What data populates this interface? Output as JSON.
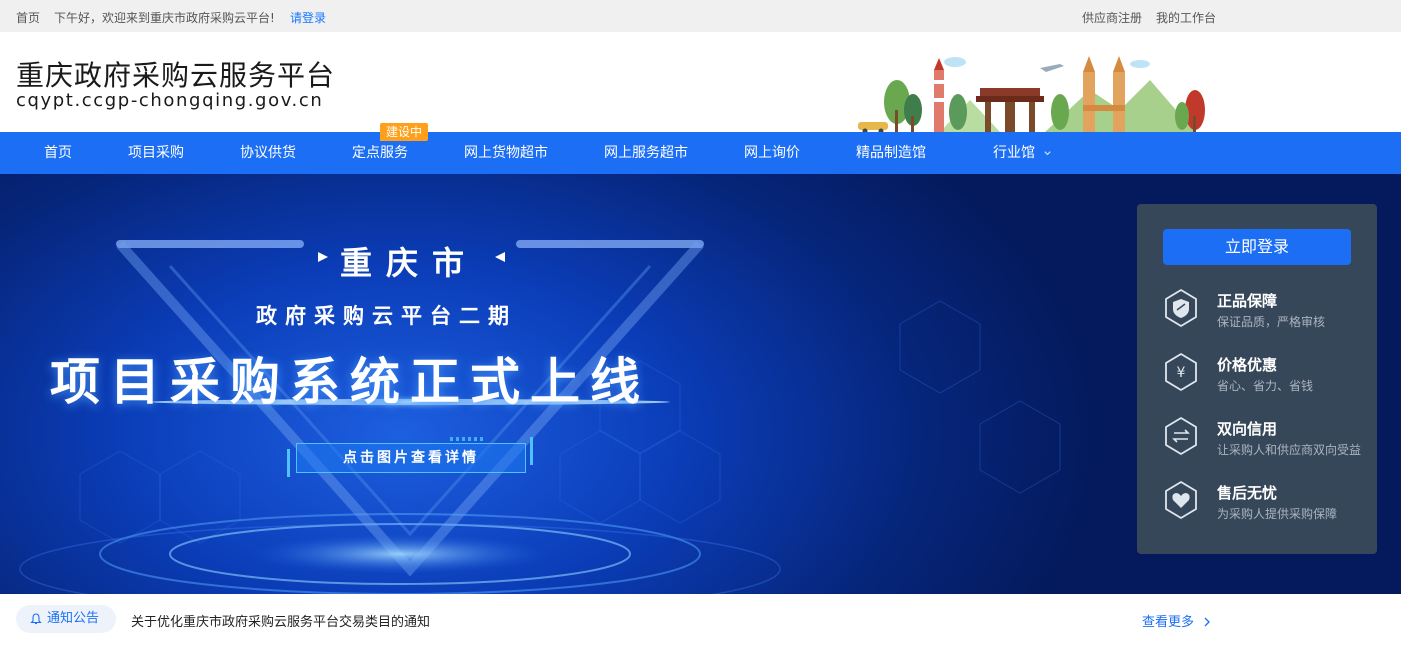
{
  "topbar": {
    "home": "首页",
    "greeting": "下午好，欢迎来到重庆市政府采购云平台!",
    "login_link": "请登录",
    "supplier_register": "供应商注册",
    "my_workspace": "我的工作台"
  },
  "header": {
    "title": "重庆政府采购云服务平台",
    "domain": "cqypt.ccgp-chongqing.gov.cn"
  },
  "nav": {
    "items": [
      {
        "label": "首页"
      },
      {
        "label": "项目采购"
      },
      {
        "label": "协议供货"
      },
      {
        "label": "定点服务"
      },
      {
        "label": "网上货物超市"
      },
      {
        "label": "网上服务超市"
      },
      {
        "label": "网上询价"
      },
      {
        "label": "精品制造馆"
      },
      {
        "label": "行业馆"
      }
    ],
    "badge": "建设中",
    "dropdown_icon": "chevron-down-icon"
  },
  "banner": {
    "title_city": "重庆市",
    "title_phase": "政府采购云平台二期",
    "title_main": "项目采购系统正式上线",
    "cta": "点击图片查看详情"
  },
  "side_panel": {
    "login_button": "立即登录",
    "features": [
      {
        "title": "正品保障",
        "desc": "保证品质，严格审核",
        "icon": "shield-icon"
      },
      {
        "title": "价格优惠",
        "desc": "省心、省力、省钱",
        "icon": "yen-icon"
      },
      {
        "title": "双向信用",
        "desc": "让采购人和供应商双向受益",
        "icon": "exchange-icon"
      },
      {
        "title": "售后无忧",
        "desc": "为采购人提供采购保障",
        "icon": "heart-hand-icon"
      }
    ]
  },
  "notice": {
    "label": "通知公告",
    "icon": "bell-icon",
    "text": "关于优化重庆市政府采购云服务平台交易类目的通知",
    "more": "查看更多"
  },
  "colors": {
    "brand_blue": "#1c6ff5",
    "badge_orange": "#ff9f1a",
    "panel_bg": "#37475a"
  }
}
